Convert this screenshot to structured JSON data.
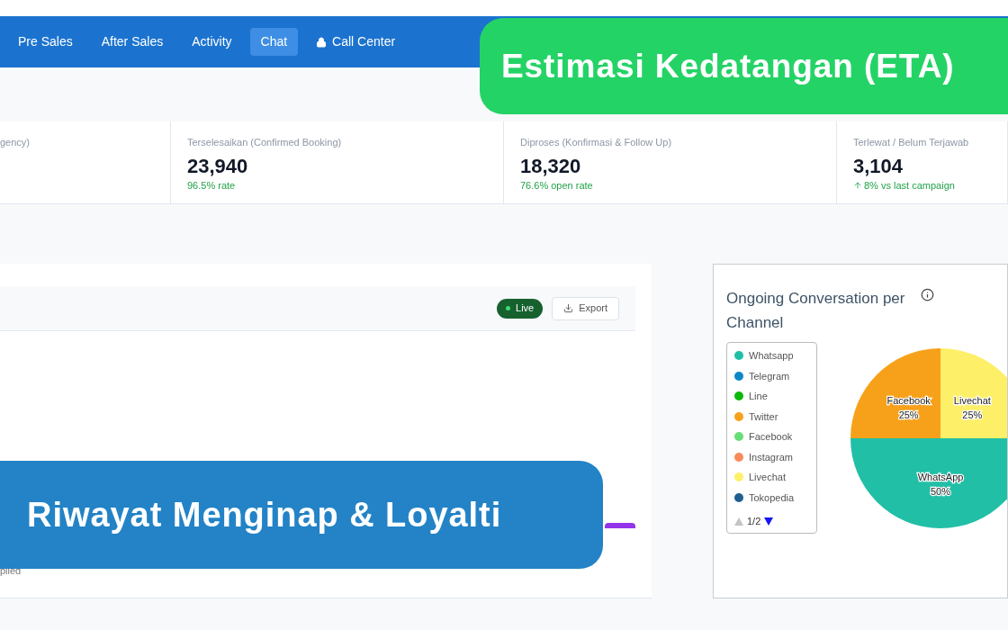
{
  "nav": {
    "items": [
      {
        "label": "Pre Sales",
        "selected": false,
        "locked": false
      },
      {
        "label": "After Sales",
        "selected": false,
        "locked": false
      },
      {
        "label": "Activity",
        "selected": false,
        "locked": false
      },
      {
        "label": "Chat",
        "selected": true,
        "locked": false
      },
      {
        "label": "Call Center",
        "selected": false,
        "locked": true
      }
    ]
  },
  "stats": [
    {
      "label": "gency)"
    },
    {
      "label": "Terselesaikan (Confirmed Booking)",
      "value": "23,940",
      "note": "96.5% rate",
      "trend_up": false
    },
    {
      "label": "Diproses (Konfirmasi & Follow Up)",
      "value": "18,320",
      "note": "76.6% open rate",
      "trend_up": false
    },
    {
      "label": "Terlewat / Belum Terjawab",
      "value": "3,104",
      "note": "8% vs last campaign",
      "trend_up": true
    }
  ],
  "main_panel": {
    "live_badge": "Live",
    "export_button": "Export",
    "footer_text": "plied"
  },
  "channel_panel": {
    "title": "Ongoing Conversation per Channel",
    "legend": [
      {
        "label": "Whatsapp",
        "color": "#20bfa5"
      },
      {
        "label": "Telegram",
        "color": "#0c88c9"
      },
      {
        "label": "Line",
        "color": "#0cb80c"
      },
      {
        "label": "Twitter",
        "color": "#f7a11b"
      },
      {
        "label": "Facebook",
        "color": "#66dd77"
      },
      {
        "label": "Instagram",
        "color": "#f98b5a"
      },
      {
        "label": "Livechat",
        "color": "#fdf06a"
      },
      {
        "label": "Tokopedia",
        "color": "#1f5f91"
      }
    ],
    "legend_page": "1/2",
    "chart_data": {
      "type": "pie",
      "categories": [
        "Livechat",
        "WhatsApp",
        "Facebook"
      ],
      "values": [
        25,
        50,
        25
      ],
      "colors": [
        "#fdef68",
        "#21bfa6",
        "#f7a11b"
      ],
      "value_labels": [
        "25%",
        "50%",
        "25%"
      ]
    }
  },
  "banners": [
    {
      "text": "Estimasi Kedatangan (ETA)",
      "kind": "top"
    },
    {
      "text": "Riwayat Menginap & Loyalti",
      "kind": "bottom"
    }
  ]
}
